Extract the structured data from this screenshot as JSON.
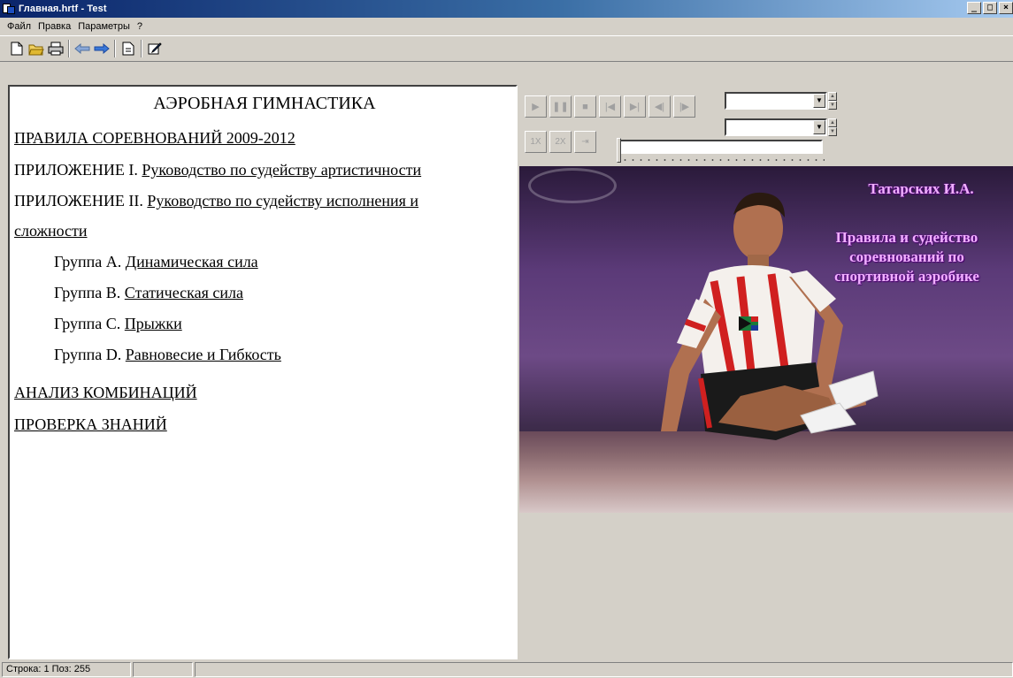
{
  "window": {
    "title": "Главная.hrtf - Test",
    "controls": [
      "_",
      "□",
      "×"
    ]
  },
  "menu": [
    "Файл",
    "Правка",
    "Параметры",
    "?"
  ],
  "toolbar": [
    "new-doc-icon",
    "open-folder-icon",
    "print-icon",
    "back-arrow-icon",
    "forward-arrow-icon",
    "page-icon",
    "edit-icon"
  ],
  "document": {
    "title": "АЭРОБНАЯ ГИМНАСТИКА",
    "rules_link": "ПРАВИЛА СОРЕВНОВАНИЙ 2009-2012",
    "app1_prefix": "ПРИЛОЖЕНИЕ I. ",
    "app1_link": "Руководство по судейству артистичности",
    "app2_prefix": "ПРИЛОЖЕНИЕ II. ",
    "app2_link_a": "Руководство по судейству исполнения и",
    "app2_link_b": "сложности",
    "groups": [
      {
        "prefix": "Группа А. ",
        "link": "Динамическая сила"
      },
      {
        "prefix": "Группа В. ",
        "link": "Статическая сила"
      },
      {
        "prefix": "Группа С. ",
        "link": "Прыжки"
      },
      {
        "prefix": "Группа D. ",
        "link": "Равновесие и Гибкость"
      }
    ],
    "analysis_link": "АНАЛИЗ КОМБИНАЦИЙ",
    "test_link": "ПРОВЕРКА ЗНАНИЙ"
  },
  "player": {
    "buttons_row1": [
      "▶",
      "❚❚",
      "■",
      "|◀",
      "▶|",
      "◀|",
      "|▶"
    ],
    "buttons_row2": [
      "1X",
      "2X",
      "⇥"
    ]
  },
  "photo": {
    "author": "Татарских И.А.",
    "subtitle_lines": [
      "Правила и судейство",
      "соревнований по",
      "спортивной аэробике"
    ]
  },
  "status": {
    "position": "Строка:  1  Поз: 255",
    "panel2": "",
    "panel3": ""
  }
}
